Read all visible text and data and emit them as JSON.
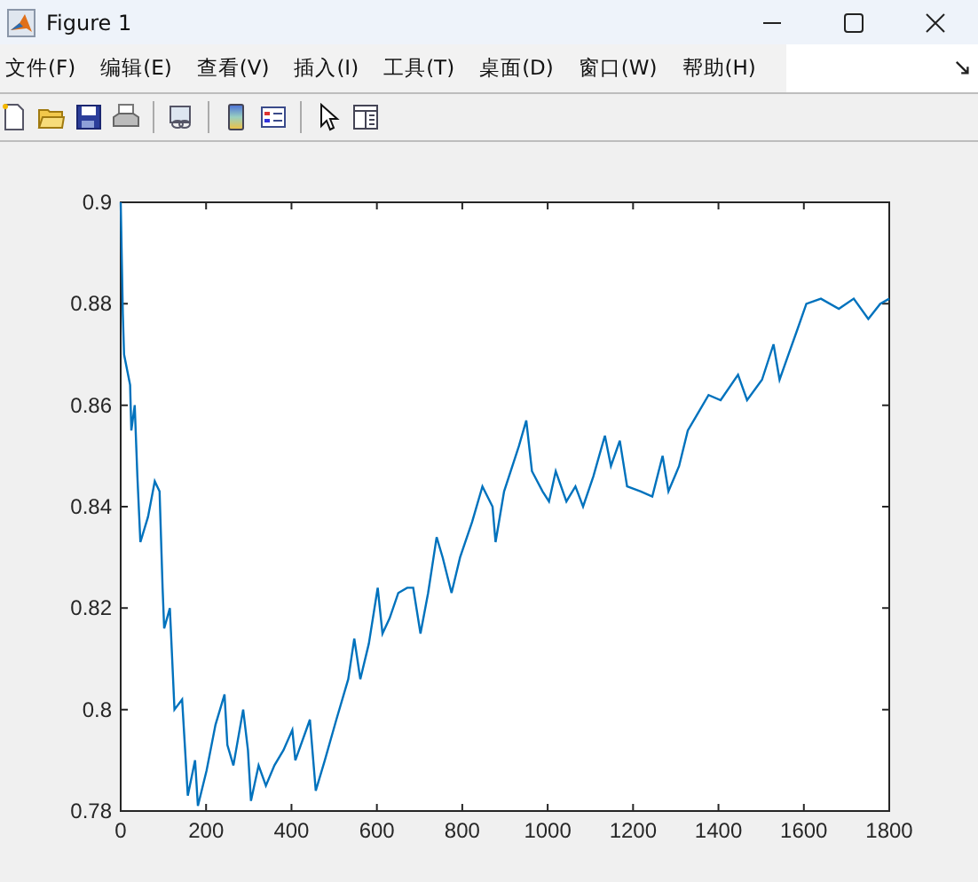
{
  "window": {
    "title": "Figure 1"
  },
  "menu": [
    "文件(F)",
    "编辑(E)",
    "查看(V)",
    "插入(I)",
    "工具(T)",
    "桌面(D)",
    "窗口(W)",
    "帮助(H)"
  ],
  "axes": {
    "chart_data": {
      "type": "line",
      "x": [
        0,
        5,
        8,
        22,
        25,
        33,
        39,
        46,
        64,
        80,
        91,
        98,
        102,
        115,
        126,
        144,
        151,
        157,
        174,
        181,
        201,
        222,
        243,
        250,
        264,
        287,
        298,
        305,
        323,
        340,
        360,
        381,
        402,
        409,
        443,
        457,
        478,
        505,
        533,
        547,
        561,
        581,
        602,
        613,
        630,
        650,
        671,
        685,
        702,
        720,
        740,
        754,
        775,
        795,
        823,
        847,
        871,
        878,
        898,
        933,
        950,
        963,
        988,
        1003,
        1019,
        1044,
        1065,
        1083,
        1107,
        1134,
        1148,
        1169,
        1186,
        1218,
        1245,
        1269,
        1283,
        1308,
        1328,
        1349,
        1377,
        1405,
        1446,
        1467,
        1502,
        1529,
        1543,
        1564,
        1585,
        1606,
        1640,
        1682,
        1717,
        1751,
        1779,
        1800
      ],
      "series": [
        {
          "color": "#0072bd",
          "values": [
            0.9,
            0.878,
            0.87,
            0.864,
            0.855,
            0.86,
            0.846,
            0.833,
            0.838,
            0.845,
            0.843,
            0.824,
            0.816,
            0.82,
            0.8,
            0.802,
            0.792,
            0.783,
            0.79,
            0.781,
            0.788,
            0.797,
            0.803,
            0.793,
            0.789,
            0.8,
            0.792,
            0.782,
            0.789,
            0.785,
            0.789,
            0.792,
            0.796,
            0.79,
            0.798,
            0.784,
            0.79,
            0.798,
            0.806,
            0.814,
            0.806,
            0.813,
            0.824,
            0.815,
            0.818,
            0.823,
            0.824,
            0.824,
            0.815,
            0.823,
            0.834,
            0.83,
            0.823,
            0.83,
            0.837,
            0.844,
            0.84,
            0.833,
            0.843,
            0.852,
            0.857,
            0.847,
            0.843,
            0.841,
            0.847,
            0.841,
            0.844,
            0.84,
            0.846,
            0.854,
            0.848,
            0.853,
            0.844,
            0.843,
            0.842,
            0.85,
            0.843,
            0.848,
            0.855,
            0.858,
            0.862,
            0.861,
            0.866,
            0.861,
            0.865,
            0.872,
            0.865,
            0.87,
            0.875,
            0.88,
            0.881,
            0.879,
            0.881,
            0.877,
            0.88,
            0.881
          ]
        }
      ],
      "xlim": [
        0,
        1800
      ],
      "ylim": [
        0.78,
        0.9
      ],
      "xticks": [
        0,
        200,
        400,
        600,
        800,
        1000,
        1200,
        1400,
        1600,
        1800
      ],
      "yticks": [
        0.78,
        0.8,
        0.82,
        0.84,
        0.86,
        0.88,
        0.9
      ]
    }
  }
}
